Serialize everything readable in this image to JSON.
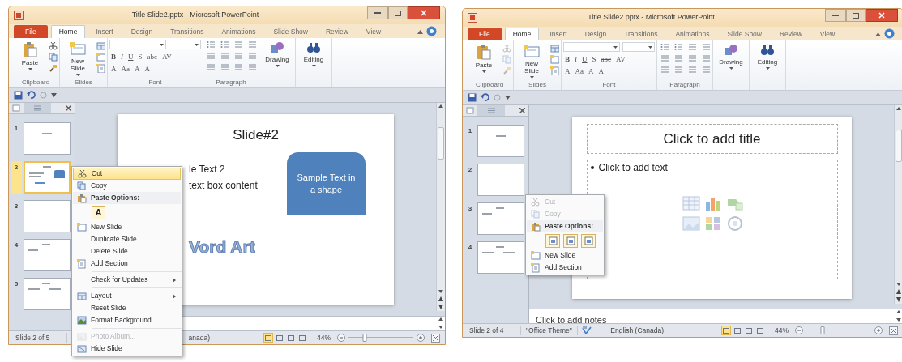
{
  "windows": [
    {
      "title": "Title Slide2.pptx - Microsoft PowerPoint",
      "tabs": [
        {
          "label": "File",
          "kind": "file",
          "selected": false
        },
        {
          "label": "Home",
          "kind": "tab",
          "selected": true
        },
        {
          "label": "Insert",
          "kind": "tab",
          "selected": false
        },
        {
          "label": "Design",
          "kind": "tab",
          "selected": false
        },
        {
          "label": "Transitions",
          "kind": "tab",
          "selected": false
        },
        {
          "label": "Animations",
          "kind": "tab",
          "selected": false
        },
        {
          "label": "Slide Show",
          "kind": "tab",
          "selected": false
        },
        {
          "label": "Review",
          "kind": "tab",
          "selected": false
        },
        {
          "label": "View",
          "kind": "tab",
          "selected": false
        }
      ],
      "ribbon": {
        "clipboard_enabled": true,
        "groups": [
          {
            "kind": "clipboard",
            "label": "Clipboard",
            "button": "Paste"
          },
          {
            "kind": "slides",
            "label": "Slides",
            "button": "New Slide"
          },
          {
            "kind": "font",
            "label": "Font",
            "row1": [
              "B",
              "I",
              "U",
              "S",
              "abc",
              "AV"
            ],
            "row2": [
              "A",
              "Aa",
              "A",
              "A"
            ]
          },
          {
            "kind": "paragraph",
            "label": "Paragraph"
          },
          {
            "kind": "drawing",
            "button": "Drawing"
          },
          {
            "kind": "editing",
            "button": "Editing"
          }
        ]
      },
      "thumbnails": [
        {
          "number": "1",
          "kind": "title",
          "selected": false
        },
        {
          "number": "2",
          "kind": "shape",
          "selected": true
        },
        {
          "number": "3",
          "kind": "blank",
          "selected": false
        },
        {
          "number": "4",
          "kind": "text",
          "selected": false
        },
        {
          "number": "5",
          "kind": "two_column",
          "selected": false
        }
      ],
      "slide": {
        "elements": [
          {
            "kind": "title",
            "text": "Slide#2"
          },
          {
            "kind": "text_line",
            "text": "le Text 2"
          },
          {
            "kind": "text_line",
            "text": "text box content"
          },
          {
            "kind": "shape",
            "text": "Sample Text in a shape"
          },
          {
            "kind": "wordart",
            "text": "Vord Art"
          }
        ]
      },
      "context_menu": {
        "items": [
          {
            "kind": "item",
            "label": "Cut",
            "icon": true,
            "highlighted": true,
            "disabled": false,
            "submenu": false
          },
          {
            "kind": "item",
            "label": "Copy",
            "icon": true,
            "highlighted": false,
            "disabled": false,
            "submenu": false
          },
          {
            "kind": "header",
            "label": "Paste Options:",
            "icon": true
          },
          {
            "kind": "paste_buttons",
            "buttons": [
              {
                "kind": "text",
                "label": "A"
              }
            ]
          },
          {
            "kind": "item",
            "label": "New Slide",
            "icon": true,
            "highlighted": false,
            "disabled": false,
            "submenu": false
          },
          {
            "kind": "item",
            "label": "Duplicate Slide",
            "icon": false,
            "highlighted": false,
            "disabled": false,
            "submenu": false
          },
          {
            "kind": "item",
            "label": "Delete Slide",
            "icon": false,
            "highlighted": false,
            "disabled": false,
            "submenu": false
          },
          {
            "kind": "item",
            "label": "Add Section",
            "icon": true,
            "highlighted": false,
            "disabled": false,
            "submenu": false
          },
          {
            "kind": "separator"
          },
          {
            "kind": "item",
            "label": "Check for Updates",
            "icon": false,
            "highlighted": false,
            "disabled": false,
            "submenu": true
          },
          {
            "kind": "separator"
          },
          {
            "kind": "item",
            "label": "Layout",
            "icon": true,
            "highlighted": false,
            "disabled": false,
            "submenu": true
          },
          {
            "kind": "item",
            "label": "Reset Slide",
            "icon": false,
            "highlighted": false,
            "disabled": false,
            "submenu": false
          },
          {
            "kind": "item",
            "label": "Format Background...",
            "icon": true,
            "highlighted": false,
            "disabled": false,
            "submenu": false
          },
          {
            "kind": "separator"
          },
          {
            "kind": "item",
            "label": "Photo Album...",
            "icon": true,
            "highlighted": false,
            "disabled": true,
            "submenu": false
          },
          {
            "kind": "item",
            "label": "Hide Slide",
            "icon": true,
            "highlighted": false,
            "disabled": false,
            "submenu": false
          }
        ]
      },
      "status": {
        "items": [
          {
            "kind": "counter",
            "text": "Slide 2 of 5"
          },
          {
            "kind": "language",
            "text": "anada)"
          }
        ],
        "view_buttons": [
          {
            "selected": true
          },
          {
            "selected": false
          },
          {
            "selected": false
          },
          {
            "selected": false
          }
        ],
        "zoom": {
          "reading": "44%",
          "level": 0.25
        }
      }
    },
    {
      "title": "Title Slide2.pptx - Microsoft PowerPoint",
      "tabs": [
        {
          "label": "File",
          "kind": "file",
          "selected": false
        },
        {
          "label": "Home",
          "kind": "tab",
          "selected": true
        },
        {
          "label": "Insert",
          "kind": "tab",
          "selected": false
        },
        {
          "label": "Design",
          "kind": "tab",
          "selected": false
        },
        {
          "label": "Transitions",
          "kind": "tab",
          "selected": false
        },
        {
          "label": "Animations",
          "kind": "tab",
          "selected": false
        },
        {
          "label": "Slide Show",
          "kind": "tab",
          "selected": false
        },
        {
          "label": "Review",
          "kind": "tab",
          "selected": false
        },
        {
          "label": "View",
          "kind": "tab",
          "selected": false
        }
      ],
      "ribbon": {
        "clipboard_enabled": false,
        "groups": [
          {
            "kind": "clipboard",
            "label": "Clipboard",
            "button": "Paste"
          },
          {
            "kind": "slides",
            "label": "Slides",
            "button": "New Slide"
          },
          {
            "kind": "font",
            "label": "Font",
            "row1": [
              "B",
              "I",
              "U",
              "S",
              "abc",
              "AV"
            ],
            "row2": [
              "A",
              "Aa",
              "A",
              "A"
            ]
          },
          {
            "kind": "paragraph",
            "label": "Paragraph"
          },
          {
            "kind": "drawing",
            "button": "Drawing"
          },
          {
            "kind": "editing",
            "button": "Editing"
          }
        ]
      },
      "thumbnails": [
        {
          "number": "1",
          "kind": "title",
          "selected": false
        },
        {
          "number": "2",
          "kind": "blank",
          "selected": false
        },
        {
          "number": "3",
          "kind": "text",
          "selected": false
        },
        {
          "number": "4",
          "kind": "two_column",
          "selected": false
        }
      ],
      "slide": {
        "elements": [
          {
            "kind": "title_placeholder",
            "text": "Click to add title"
          },
          {
            "kind": "body_placeholder",
            "text": "Click to add text"
          }
        ]
      },
      "notes": "Click to add notes",
      "context_menu": {
        "items": [
          {
            "kind": "item",
            "label": "Cut",
            "icon": true,
            "highlighted": false,
            "disabled": true,
            "submenu": false
          },
          {
            "kind": "item",
            "label": "Copy",
            "icon": true,
            "highlighted": false,
            "disabled": true,
            "submenu": false
          },
          {
            "kind": "header",
            "label": "Paste Options:",
            "icon": true
          },
          {
            "kind": "paste_buttons",
            "buttons": [
              {
                "kind": "icon"
              },
              {
                "kind": "icon"
              },
              {
                "kind": "icon"
              }
            ]
          },
          {
            "kind": "item",
            "label": "New Slide",
            "icon": true,
            "highlighted": false,
            "disabled": false,
            "submenu": false
          },
          {
            "kind": "item",
            "label": "Add Section",
            "icon": true,
            "highlighted": false,
            "disabled": false,
            "submenu": false
          }
        ]
      },
      "status": {
        "items": [
          {
            "kind": "counter",
            "text": "Slide 2 of 4"
          },
          {
            "kind": "theme",
            "text": "\"Office Theme\""
          },
          {
            "kind": "spelling"
          },
          {
            "kind": "language",
            "text": "English (Canada)"
          }
        ],
        "view_buttons": [
          {
            "selected": true
          },
          {
            "selected": false
          },
          {
            "selected": false
          },
          {
            "selected": false
          }
        ],
        "zoom": {
          "reading": "44%",
          "level": 0.25
        }
      }
    }
  ]
}
